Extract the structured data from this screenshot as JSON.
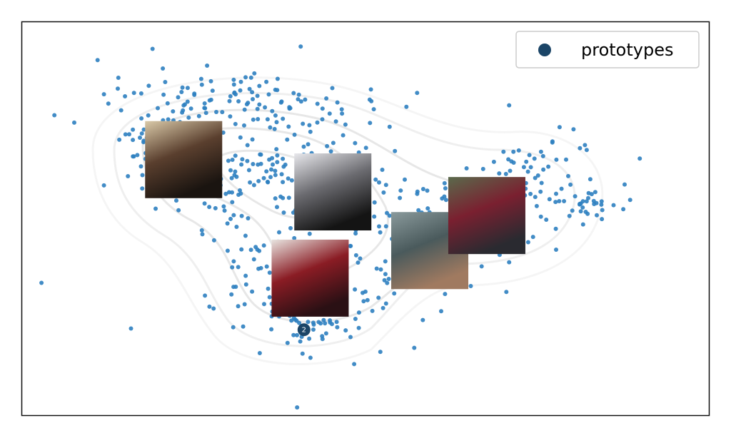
{
  "chart_data": {
    "type": "scatter",
    "title": "",
    "xlabel": "",
    "ylabel": "",
    "xlim": [
      0,
      100
    ],
    "ylim": [
      0,
      100
    ],
    "grid": false,
    "ticks": false,
    "legend": {
      "placement": "top-right",
      "entries": [
        {
          "label": "prototypes",
          "color": "#1b4567"
        }
      ]
    },
    "point_color": "#2e7fc0",
    "seed": 7,
    "clusters": [
      {
        "cx": 21.8,
        "cy": 69.2,
        "sx": 5.2,
        "sy": 7.2,
        "n": 120
      },
      {
        "cx": 38.4,
        "cy": 60.1,
        "sx": 8.3,
        "sy": 10.9,
        "n": 200
      },
      {
        "cx": 41.5,
        "cy": 27.5,
        "sx": 6.2,
        "sy": 6.3,
        "n": 120
      },
      {
        "cx": 57.1,
        "cy": 45.7,
        "sx": 6.2,
        "sy": 9.0,
        "n": 110
      },
      {
        "cx": 75.8,
        "cy": 58.3,
        "sx": 5.2,
        "sy": 7.2,
        "n": 80
      },
      {
        "cx": 83.1,
        "cy": 54.7,
        "sx": 2.1,
        "sy": 2.2,
        "n": 20
      },
      {
        "cx": 30.1,
        "cy": 80.1,
        "sx": 10.4,
        "sy": 3.6,
        "n": 80
      }
    ],
    "prototypes": [
      {
        "label": "2",
        "x": 41.1,
        "y": 21.7
      }
    ],
    "prototype_images": [
      {
        "name": "woman-cowboy-hat",
        "x": 23.6,
        "y": 64.9,
        "colors": [
          "#d9c9a8",
          "#5a3f2e",
          "#1a1410"
        ]
      },
      {
        "name": "man-white-hat-bw",
        "x": 45.3,
        "y": 56.7,
        "colors": [
          "#e8e8ec",
          "#6b6b70",
          "#141414"
        ]
      },
      {
        "name": "white-hat-red-shirt",
        "x": 42.0,
        "y": 34.8,
        "colors": [
          "#e8e4e0",
          "#8a1c24",
          "#2a1014"
        ]
      },
      {
        "name": "street-people-hats",
        "x": 59.4,
        "y": 41.8,
        "colors": [
          "#8a9a9c",
          "#4a5a5c",
          "#a07a60"
        ]
      },
      {
        "name": "performers-hats",
        "x": 67.7,
        "y": 50.7,
        "colors": [
          "#5a6a4c",
          "#7a2030",
          "#2a2a30"
        ]
      }
    ]
  }
}
